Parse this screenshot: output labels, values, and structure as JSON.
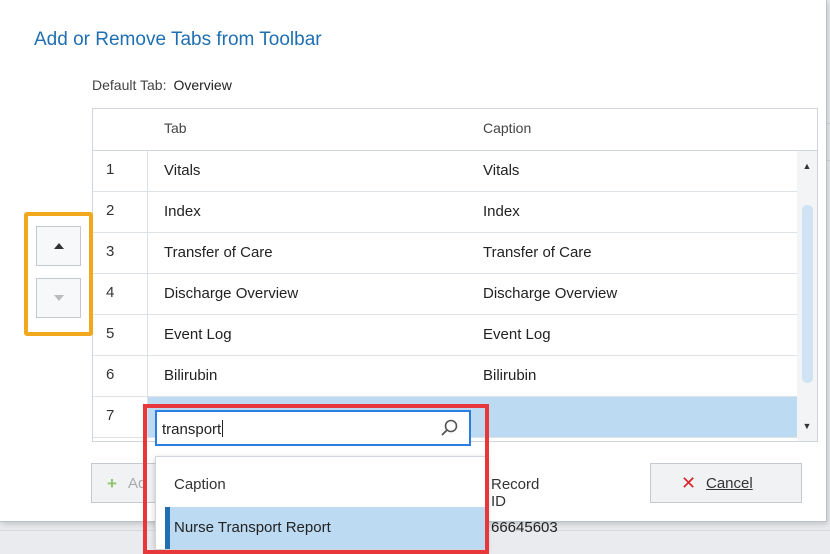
{
  "dialog": {
    "title": "Add or Remove Tabs from Toolbar",
    "default_tab_label": "Default Tab:",
    "default_tab_value": "Overview"
  },
  "grid": {
    "headers": {
      "number": "",
      "tab": "Tab",
      "caption": "Caption"
    },
    "rows": [
      {
        "num": "1",
        "tab": "Vitals",
        "caption": "Vitals"
      },
      {
        "num": "2",
        "tab": "Index",
        "caption": "Index"
      },
      {
        "num": "3",
        "tab": "Transfer of Care",
        "caption": "Transfer of Care"
      },
      {
        "num": "4",
        "tab": "Discharge Overview",
        "caption": "Discharge Overview"
      },
      {
        "num": "5",
        "tab": "Event Log",
        "caption": "Event Log"
      },
      {
        "num": "6",
        "tab": "Bilirubin",
        "caption": "Bilirubin"
      },
      {
        "num": "7",
        "tab": "",
        "caption": ""
      }
    ],
    "selected_row": 7
  },
  "search": {
    "value": "transport",
    "icon": "search-icon"
  },
  "dropdown": {
    "headers": {
      "caption": "Caption",
      "record_id": "Record ID"
    },
    "results": [
      {
        "caption": "Nurse Transport Report",
        "record_id": "66645603"
      }
    ]
  },
  "buttons": {
    "add_label": "Ad",
    "cancel_label": "Cancel",
    "move_up_icon": "arrow-up-icon",
    "move_down_icon": "arrow-down-icon"
  },
  "colors": {
    "title": "#1f6fb2",
    "selection": "#bcdaf2",
    "focus_border": "#2b7de0",
    "annotation_red": "#e8373a",
    "annotation_orange": "#f2a81d",
    "cancel_x": "#d9262b",
    "add_plus": "#8cc56a"
  }
}
